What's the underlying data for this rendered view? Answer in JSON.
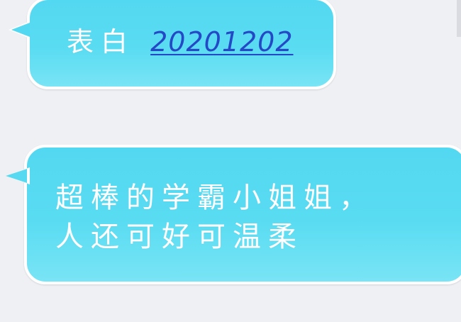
{
  "chat": {
    "messages": [
      {
        "text_prefix": "表白",
        "link_text": "20201202"
      },
      {
        "line_1": "超棒的学霸小姐姐，",
        "line_2": "人还可好可温柔"
      }
    ]
  },
  "colors": {
    "background": "#eef0f4",
    "bubble": "#56d9f1",
    "bubble_border": "#ffffff",
    "text": "#ffffff",
    "link": "#2449c7"
  }
}
